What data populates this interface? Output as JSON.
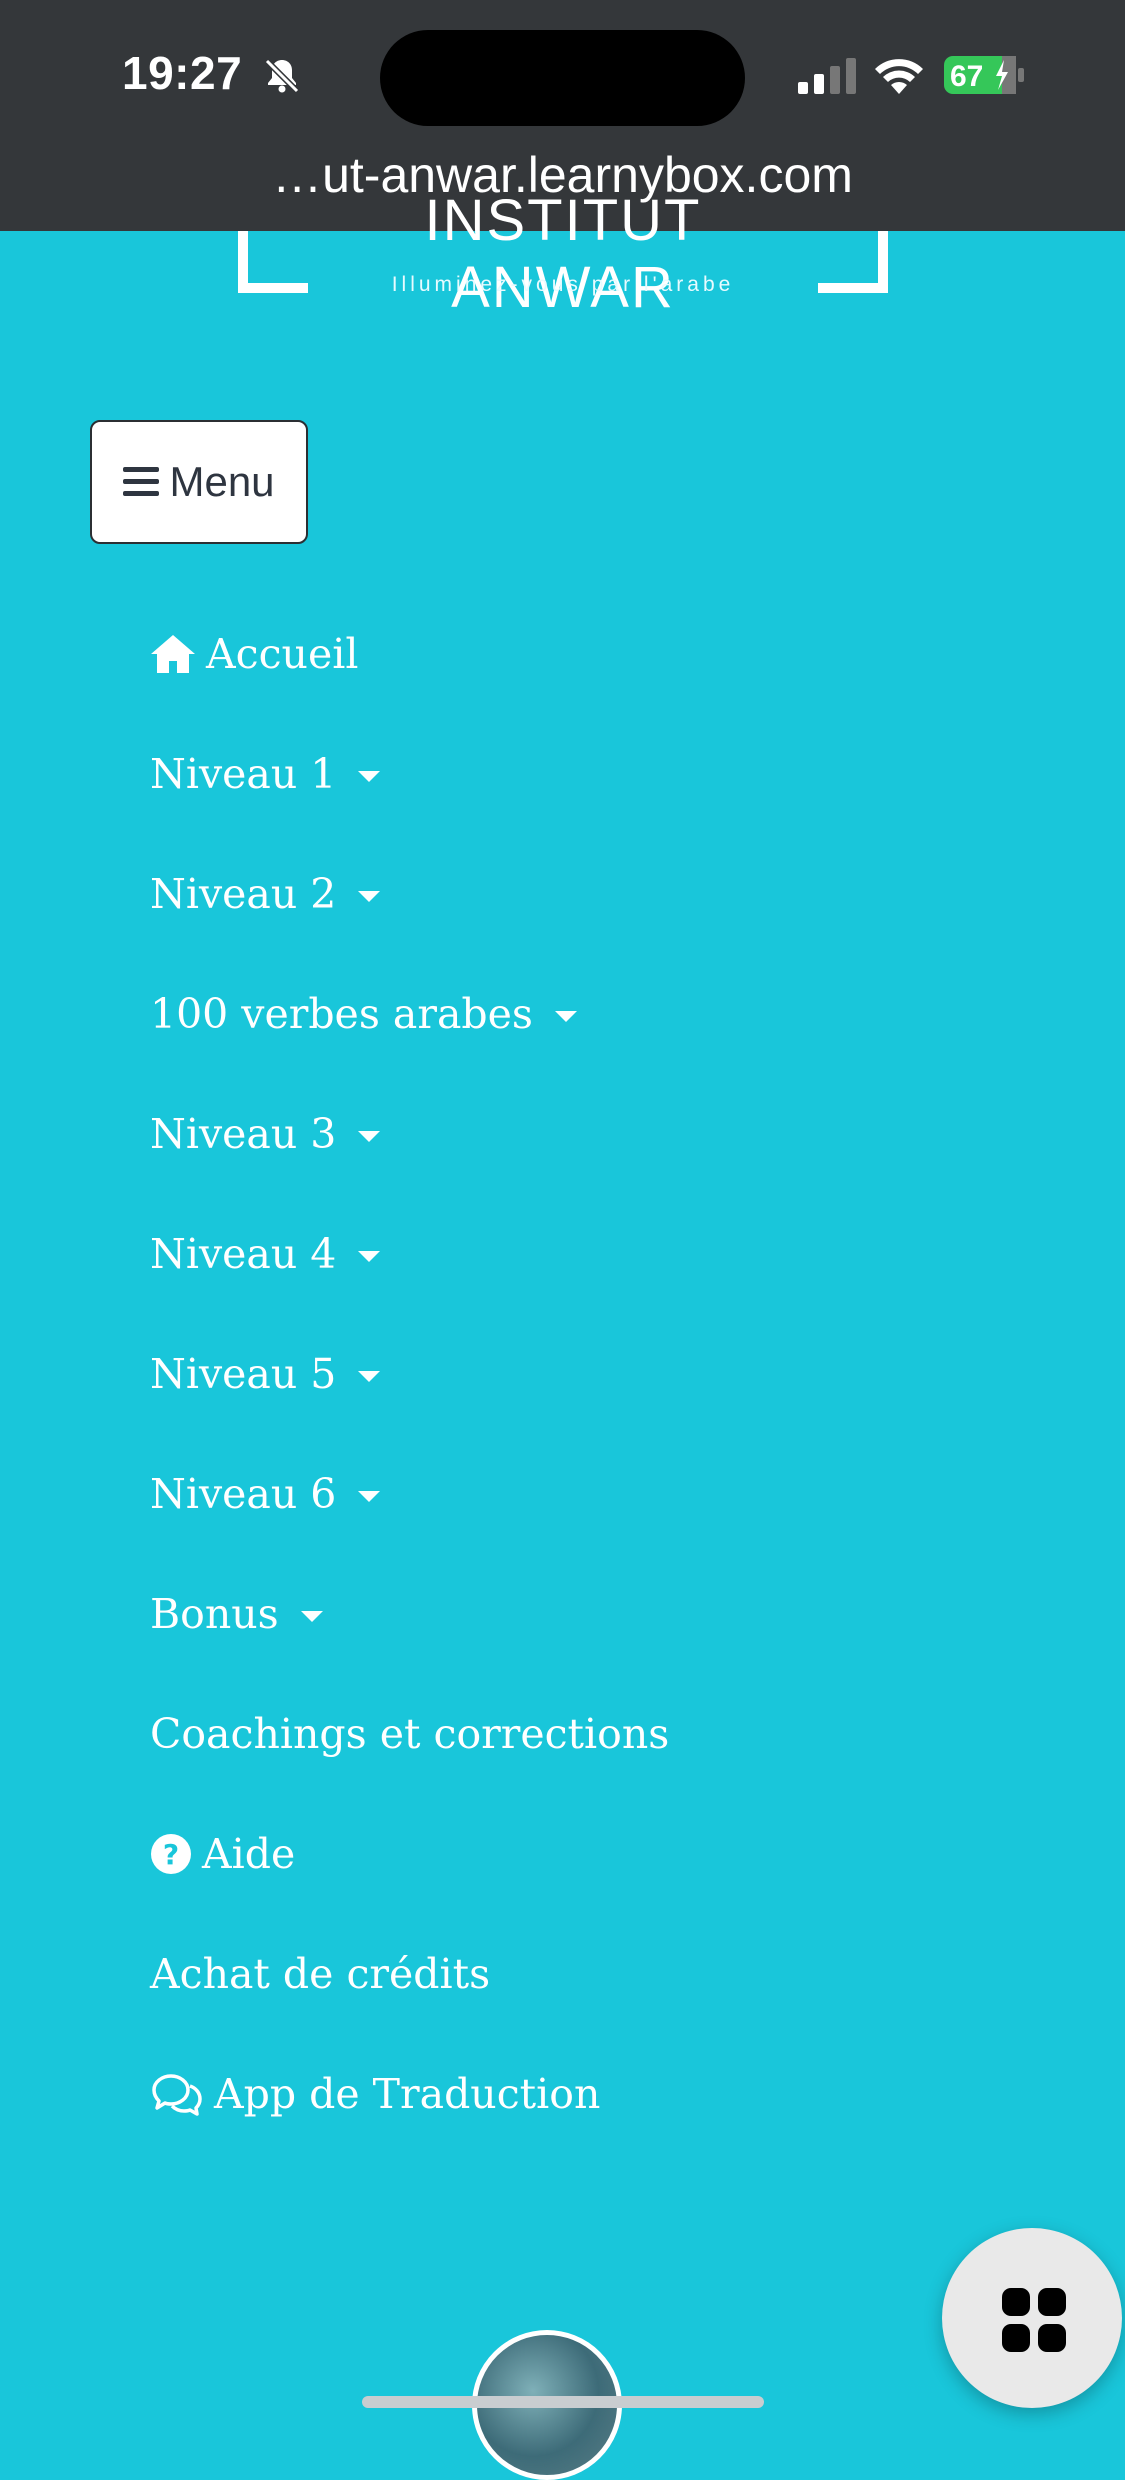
{
  "status_bar": {
    "time": "19:27",
    "battery": "67"
  },
  "browser": {
    "url": "…ut-anwar.learnybox.com"
  },
  "logo": {
    "title": "INSTITUT ANWAR",
    "tagline": "Illuminez-vous par l'arabe"
  },
  "menu_button": {
    "label": "Menu",
    "icon": "hamburger-icon"
  },
  "nav": {
    "items": [
      {
        "label": "Accueil",
        "icon": "home-icon",
        "dropdown": false
      },
      {
        "label": "Niveau 1",
        "dropdown": true
      },
      {
        "label": "Niveau 2",
        "dropdown": true
      },
      {
        "label": "100 verbes arabes",
        "dropdown": true
      },
      {
        "label": "Niveau 3",
        "dropdown": true
      },
      {
        "label": "Niveau 4",
        "dropdown": true
      },
      {
        "label": "Niveau 5",
        "dropdown": true
      },
      {
        "label": "Niveau 6",
        "dropdown": true
      },
      {
        "label": "Bonus",
        "dropdown": true
      },
      {
        "label": "Coachings et corrections",
        "dropdown": false
      },
      {
        "label": "Aide",
        "icon": "question-circle-icon",
        "dropdown": false
      },
      {
        "label": "Achat de crédits",
        "dropdown": false
      },
      {
        "label": "App de Traduction",
        "icon": "chat-bubbles-icon",
        "dropdown": false
      }
    ]
  },
  "fab": {
    "icon": "apps-grid-icon"
  },
  "colors": {
    "page_background": "#19c6da",
    "top_bar": "#34373a",
    "battery_green": "#35c759"
  }
}
